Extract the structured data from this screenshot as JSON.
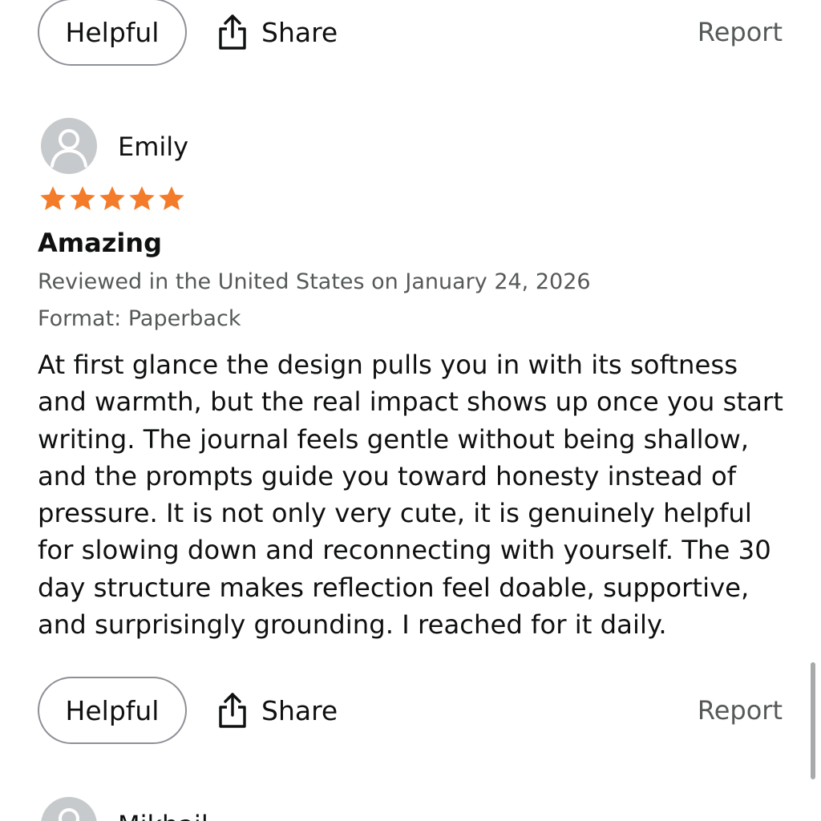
{
  "actions_top": {
    "helpful_label": "Helpful",
    "share_label": "Share",
    "report_label": "Report"
  },
  "review": {
    "reviewer": "Emily",
    "rating": 5,
    "rating_max": 5,
    "star_color": "#f47b2a",
    "title": "Amazing",
    "reviewed_in": "Reviewed in the United States on January 24, 2026",
    "format": "Format: Paperback",
    "body": "At first glance the design pulls you in with its softness and warmth, but the real impact shows up once you start writing. The journal feels gentle without being shallow, and the prompts guide you toward honesty instead of pressure. It is not only very cute, it is genuinely helpful for slowing down and reconnecting with yourself. The 30 day structure makes reflection feel doable, supportive, and surprisingly grounding. I reached for it daily."
  },
  "actions_bottom": {
    "helpful_label": "Helpful",
    "share_label": "Share",
    "report_label": "Report"
  },
  "next_review": {
    "reviewer": "Mikhail"
  },
  "icons": {
    "share": "share-icon",
    "avatar": "person-icon",
    "star": "star-icon"
  }
}
